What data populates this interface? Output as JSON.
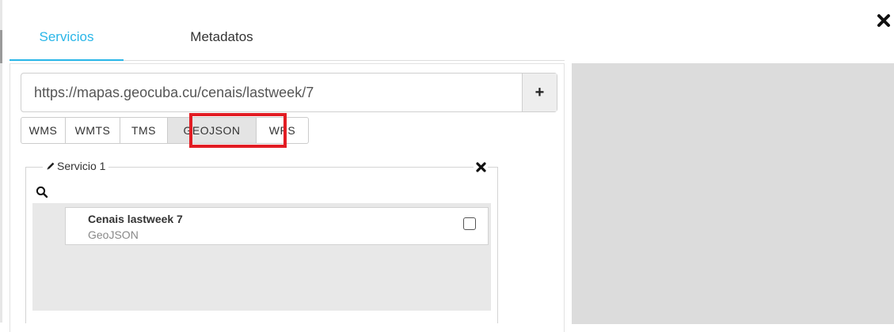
{
  "dialog": {
    "close_icon": "close-icon"
  },
  "tabs": [
    {
      "label": "Servicios",
      "active": true
    },
    {
      "label": "Metadatos",
      "active": false
    }
  ],
  "url_bar": {
    "value": "https://mapas.geocuba.cu/cenais/lastweek/7",
    "add_label": "+"
  },
  "service_types": [
    {
      "label": "WMS",
      "active": false
    },
    {
      "label": "WMTS",
      "active": false
    },
    {
      "label": "TMS",
      "active": false
    },
    {
      "label": "GEOJSON",
      "active": true
    },
    {
      "label": "WPS",
      "active": false
    }
  ],
  "service": {
    "title": "Servicio 1",
    "edit_icon": "pencil-icon",
    "close_icon": "close-icon",
    "search_icon": "search-icon",
    "layers": [
      {
        "title": "Cenais lastweek 7",
        "type": "GeoJSON",
        "checked": false
      }
    ]
  },
  "colors": {
    "accent": "#29b6e8",
    "highlight": "#e21c23",
    "preview_bg": "#dcdcdc",
    "list_bg": "#e8e8e8"
  }
}
